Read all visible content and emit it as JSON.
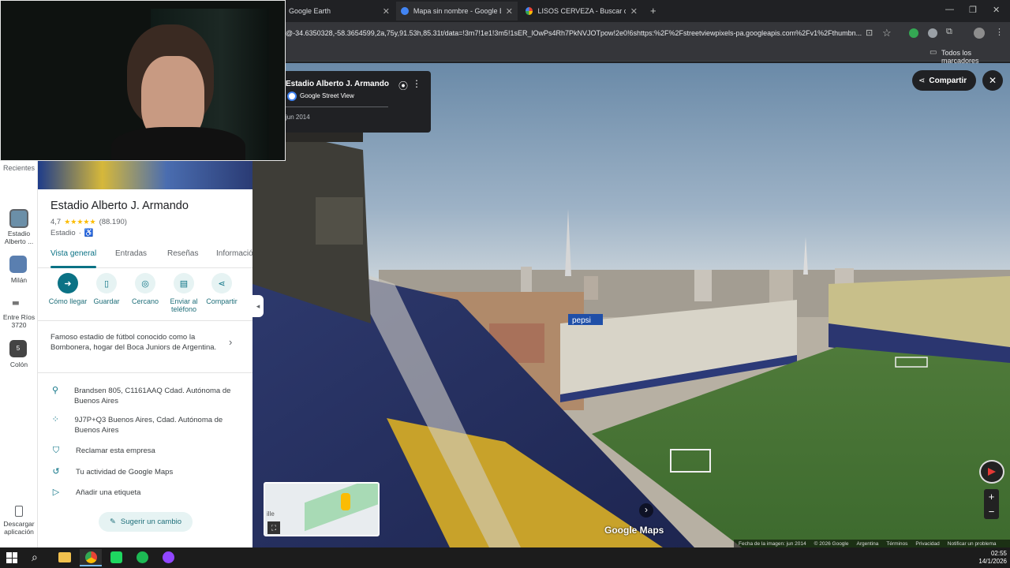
{
  "browser": {
    "tabs": [
      {
        "title": "Google Earth"
      },
      {
        "title": "Mapa sin nombre - Google Earth"
      },
      {
        "title": "LISOS CERVEZA - Buscar con Google"
      }
    ],
    "new_tab": "+",
    "url": "@-34.6350328,-58.3654599,2a,75y,91.53h,85.31t/data=!3m7!1e1!3m5!1sER_lOwPs4Rh7PkNVJOTpow!2e0!6shttps:%2F%2Fstreetviewpixels-pa.googleapis.com%2Fv1%2Fthumbn...",
    "bookmarks_label": "Todos los marcadores"
  },
  "streetview": {
    "place_title": "Estadio Alberto J. Armando",
    "source": "Google Street View",
    "date": "jun 2014",
    "share_label": "Compartir",
    "watermark": "Google Maps",
    "footer": {
      "image_date": "Fecha de la imagen: jun 2014",
      "copyright": "© 2026 Google",
      "country": "Argentina",
      "terms": "Términos",
      "privacy": "Privacidad",
      "report": "Notificar un problema"
    },
    "minimap_text": "ille",
    "billboard": "pepsi"
  },
  "rail": {
    "items": [
      {
        "label": "Recientes"
      },
      {
        "label": "Estadio Alberto ..."
      },
      {
        "label": "Milán"
      },
      {
        "label": "Entre Ríos 3720"
      },
      {
        "label": "Colón"
      }
    ],
    "badge": "5",
    "download_label": "Descargar aplicación"
  },
  "panel": {
    "title": "Estadio Alberto J. Armando",
    "rating": "4,7",
    "stars": "★★★★★",
    "reviews": "(88.190)",
    "category": "Estadio",
    "tabs": [
      "Vista general",
      "Entradas",
      "Reseñas",
      "Información"
    ],
    "actions": [
      {
        "label": "Cómo llegar"
      },
      {
        "label": "Guardar"
      },
      {
        "label": "Cercano"
      },
      {
        "label": "Enviar al teléfono"
      },
      {
        "label": "Compartir"
      }
    ],
    "description": "Famoso estadio de fútbol conocido como la Bombonera, hogar del Boca Juniors de Argentina.",
    "info": [
      {
        "text": "Brandsen 805, C1161AAQ Cdad. Autónoma de Buenos Aires"
      },
      {
        "text": "9J7P+Q3 Buenos Aires, Cdad. Autónoma de Buenos Aires"
      },
      {
        "text": "Reclamar esta empresa"
      },
      {
        "text": "Tu actividad de Google Maps"
      },
      {
        "text": "Añadir una etiqueta"
      }
    ],
    "suggest_label": "Sugerir un cambio"
  },
  "taskbar": {
    "time": "02:55",
    "date": "14/1/2026"
  },
  "colors": {
    "accent": "#0b7285",
    "star": "#fbbc04"
  }
}
